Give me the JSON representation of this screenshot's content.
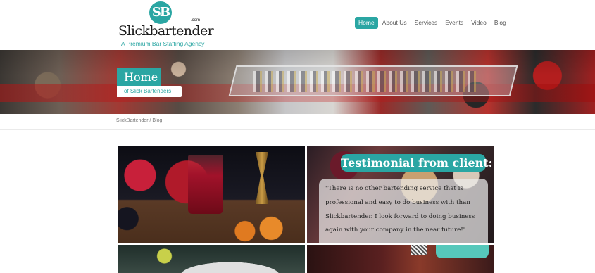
{
  "header": {
    "logo_mark": "SB",
    "logo_word": "Slickbartender",
    "logo_suffix": ".com",
    "tagline": "A Premium Bar Staffing Agency",
    "nav": [
      {
        "label": "Home",
        "active": true
      },
      {
        "label": "About Us",
        "active": false
      },
      {
        "label": "Services",
        "active": false
      },
      {
        "label": "Events",
        "active": false
      },
      {
        "label": "Video",
        "active": false
      },
      {
        "label": "Blog",
        "active": false
      }
    ]
  },
  "hero": {
    "title": "Home",
    "subtitle": "of Slick Bartenders"
  },
  "breadcrumb": "SlickBartender / Blog",
  "testimonial": {
    "heading": "Testimonial from client:",
    "quote": "\"There is no other bartending service that  is professional and easy to do business with  than Slickbartender. I look forward to doing business again with your company in the near future!\""
  },
  "colors": {
    "accent": "#2aa6a3"
  }
}
